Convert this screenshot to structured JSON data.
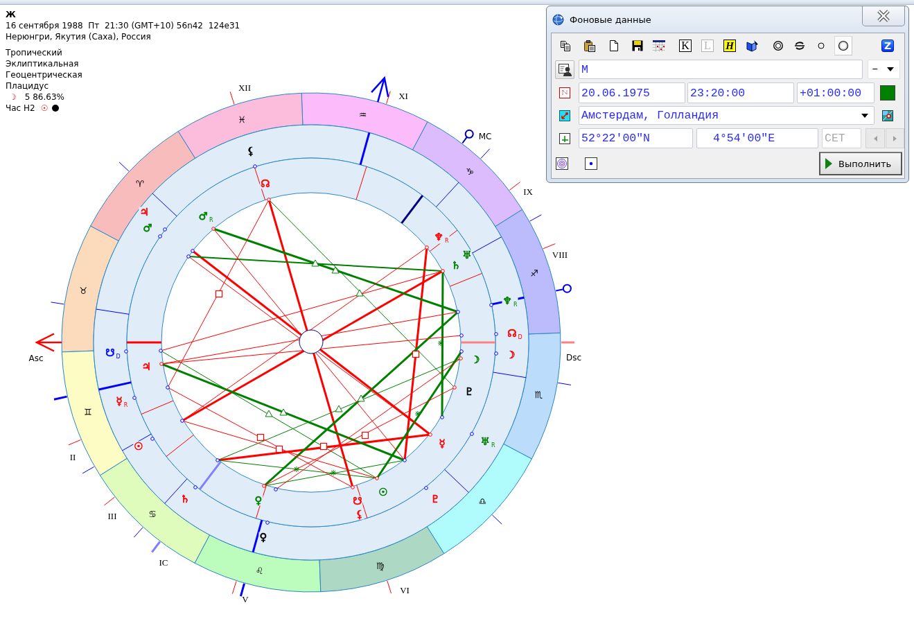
{
  "chart_info": {
    "title": "Ж",
    "datetime": "16 сентября 1988  Пт  21:30 (GMT+10) 56n42  124e31",
    "place": "Нерюнгри, Якутия (Саха), Россия",
    "settings": [
      "Тропический",
      "Эклиптикальная",
      "Геоцентрическая",
      "Плацидус"
    ],
    "moon": {
      "symbol": "☽",
      "phase": "5 86.63%"
    },
    "hour": {
      "label": "Час Н2",
      "symbol": "☉"
    }
  },
  "wheel": {
    "house_labels": [
      "XII",
      "XI",
      "MC",
      "IX",
      "VIII",
      "Dsc",
      "Asc",
      "II",
      "III",
      "IC",
      "V",
      "VI"
    ],
    "signs": [
      "♈",
      "♉",
      "♊",
      "♋",
      "♌",
      "♍",
      "♎",
      "♏",
      "♐",
      "♑",
      "♒",
      "♓"
    ],
    "outer_planets": [
      {
        "symbol": "⚸",
        "color": "#000000"
      },
      {
        "symbol": "♃",
        "color": "#ff0000"
      },
      {
        "symbol": "♂",
        "color": "#008000"
      },
      {
        "symbol": "♆$_{R}$",
        "color": "#008000"
      },
      {
        "symbol": "☊$_{D}$",
        "color": "#ff0000"
      },
      {
        "symbol": "☋$_{D}$",
        "color": "#0000ff"
      },
      {
        "symbol": "☽",
        "color": "#ff0000"
      },
      {
        "symbol": "☿$_{R}$",
        "color": "#ff0000"
      },
      {
        "symbol": "♅$_{R}$",
        "color": "#008000"
      },
      {
        "symbol": "☉",
        "color": "#ff0000"
      },
      {
        "symbol": "♄",
        "color": "#ff0000"
      },
      {
        "symbol": "♇",
        "color": "#ff0000"
      },
      {
        "symbol": "♀",
        "color": "#000000"
      }
    ],
    "inner_planets": [
      {
        "symbol": "☊",
        "color": "#ff0000"
      },
      {
        "symbol": "♂$_{R}$",
        "color": "#008000"
      },
      {
        "symbol": "♆$_{R}$",
        "color": "#ff0000"
      },
      {
        "symbol": "♅",
        "color": "#008000"
      },
      {
        "symbol": "♄",
        "color": "#008000"
      },
      {
        "symbol": "☽",
        "color": "#008000"
      },
      {
        "symbol": "♃",
        "color": "#ff0000"
      },
      {
        "symbol": "♇",
        "color": "#000000"
      },
      {
        "symbol": "☿",
        "color": "#ff0000"
      },
      {
        "symbol": "☉",
        "color": "#008000"
      },
      {
        "symbol": "♀",
        "color": "#008000"
      },
      {
        "symbol": "☋",
        "color": "#ff0000"
      },
      {
        "symbol": "⚸",
        "color": "#ff0000"
      }
    ]
  },
  "dialog": {
    "title": "Фоновые данные",
    "toolbar": [
      {
        "kind": "copy",
        "selected": false,
        "disabled": false
      },
      {
        "kind": "paste",
        "selected": false,
        "disabled": false
      },
      {
        "kind": "new",
        "selected": false,
        "disabled": false
      },
      {
        "kind": "save",
        "selected": false,
        "disabled": false
      },
      {
        "kind": "calendar",
        "selected": false,
        "disabled": false
      },
      {
        "kind": "boxed-letter",
        "label": "K",
        "selected": false,
        "disabled": false
      },
      {
        "kind": "boxed-letter",
        "label": "L",
        "selected": false,
        "disabled": true
      },
      {
        "kind": "highlight-letter",
        "label": "H",
        "selected": false,
        "disabled": false
      },
      {
        "kind": "book",
        "selected": false,
        "disabled": false
      },
      {
        "kind": "double-ring",
        "selected": false,
        "disabled": false
      },
      {
        "kind": "swap",
        "selected": false,
        "disabled": false
      },
      {
        "kind": "small-ring",
        "selected": false,
        "disabled": false
      },
      {
        "kind": "ring",
        "selected": true,
        "disabled": false
      },
      {
        "kind": "badge-letter",
        "label": "Z",
        "selected": false,
        "disabled": false
      }
    ],
    "name_field": {
      "value": "М"
    },
    "type_select": {
      "value": "–"
    },
    "date_field": {
      "value": "20.06.1975"
    },
    "time_field": {
      "value": "23:20:00"
    },
    "offset_field": {
      "value": "+01:00:00"
    },
    "color_swatch": {
      "color": "#008000"
    },
    "place_combo": {
      "value": "Амстердам, Голландия"
    },
    "latitude_field": {
      "value": "52°22'00\"N"
    },
    "longitude_field": {
      "value": "4°54'00\"E"
    },
    "zone_field": {
      "value": "CET",
      "disabled": true
    },
    "run_button": {
      "label": "Выполнить"
    }
  }
}
